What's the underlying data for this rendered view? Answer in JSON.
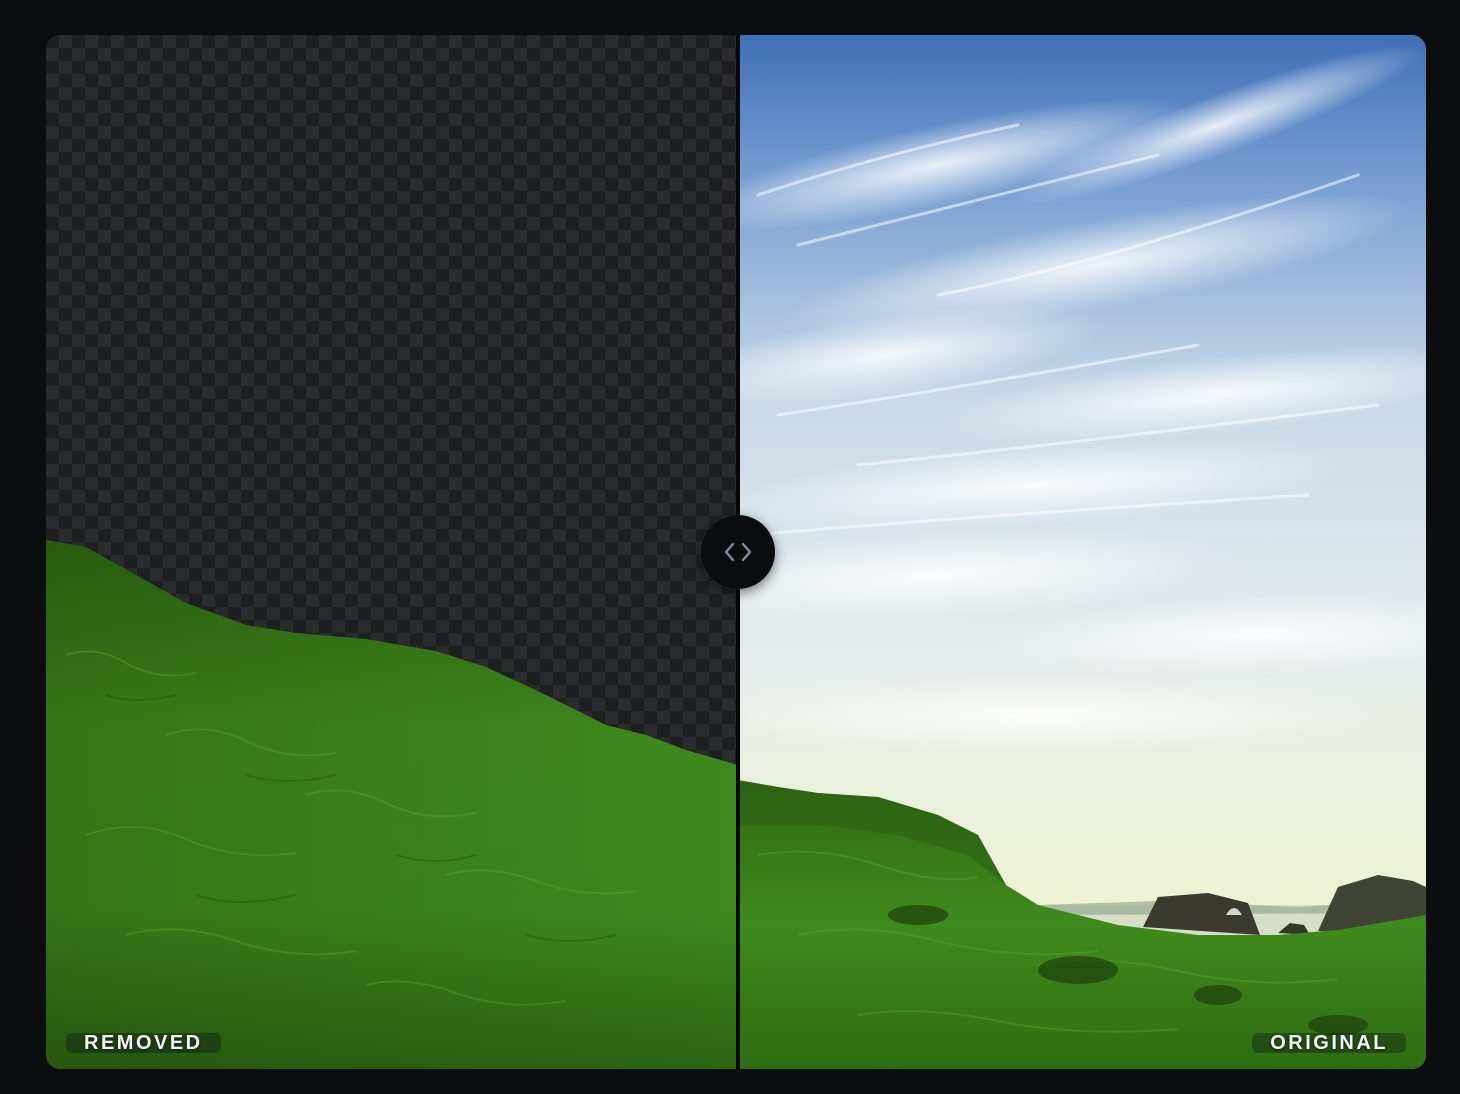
{
  "compare_viewer": {
    "left_label": "REMOVED",
    "right_label": "ORIGINAL",
    "handle_icon": "chevrons-left-right-icon",
    "divider_position_fraction": 0.5
  },
  "colors": {
    "page_background": "#0c0d0f",
    "checker_dark": "#1e1f21",
    "checker_light": "#2a2b2d",
    "handle_background": "#0b0c0e",
    "handle_icon_color": "#7d8da6",
    "label_text": "#f4f5f7"
  }
}
